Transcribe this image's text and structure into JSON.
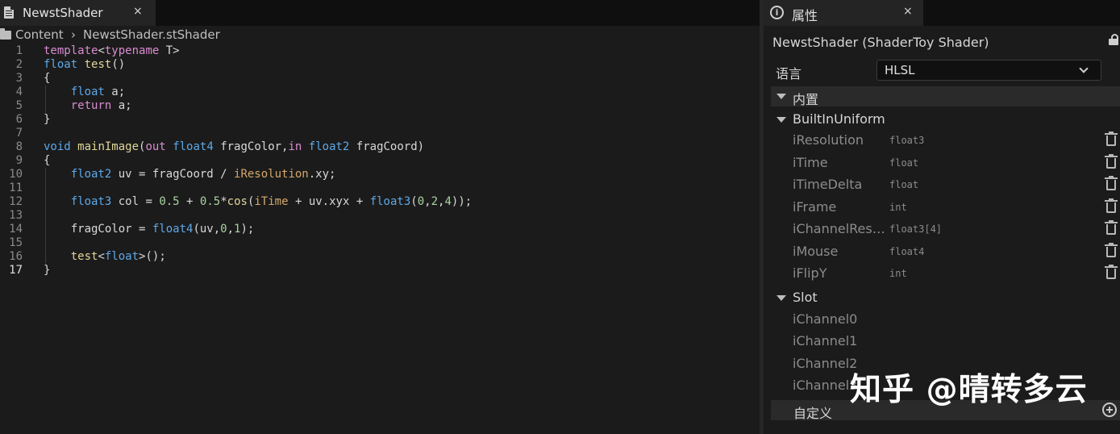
{
  "editor": {
    "tab": {
      "title": "NewstShader",
      "close": "×",
      "icon": "document-icon"
    },
    "breadcrumb": {
      "root": "Content",
      "separator": "›",
      "file": "NewstShader.stShader"
    },
    "current_line": 17
  },
  "details": {
    "tab": {
      "title": "属性",
      "close": "×",
      "icon": "info-icon"
    },
    "object_title": "NewstShader (ShaderToy Shader)",
    "language": {
      "label": "语言",
      "value": "HLSL"
    },
    "category_builtin": "内置",
    "group_uniform": "BuiltInUniform",
    "uniforms": [
      {
        "name": "iResolution",
        "type": "float3"
      },
      {
        "name": "iTime",
        "type": "float"
      },
      {
        "name": "iTimeDelta",
        "type": "float"
      },
      {
        "name": "iFrame",
        "type": "int"
      },
      {
        "name": "iChannelResolution",
        "display": "iChannelReso...",
        "type": "float3[4]"
      },
      {
        "name": "iMouse",
        "type": "float4"
      },
      {
        "name": "iFlipY",
        "type": "int"
      }
    ],
    "group_slot": "Slot",
    "slots": [
      "iChannel0",
      "iChannel1",
      "iChannel2",
      "iChannel3"
    ],
    "category_custom": "自定义"
  },
  "watermark": "知乎 @晴转多云"
}
